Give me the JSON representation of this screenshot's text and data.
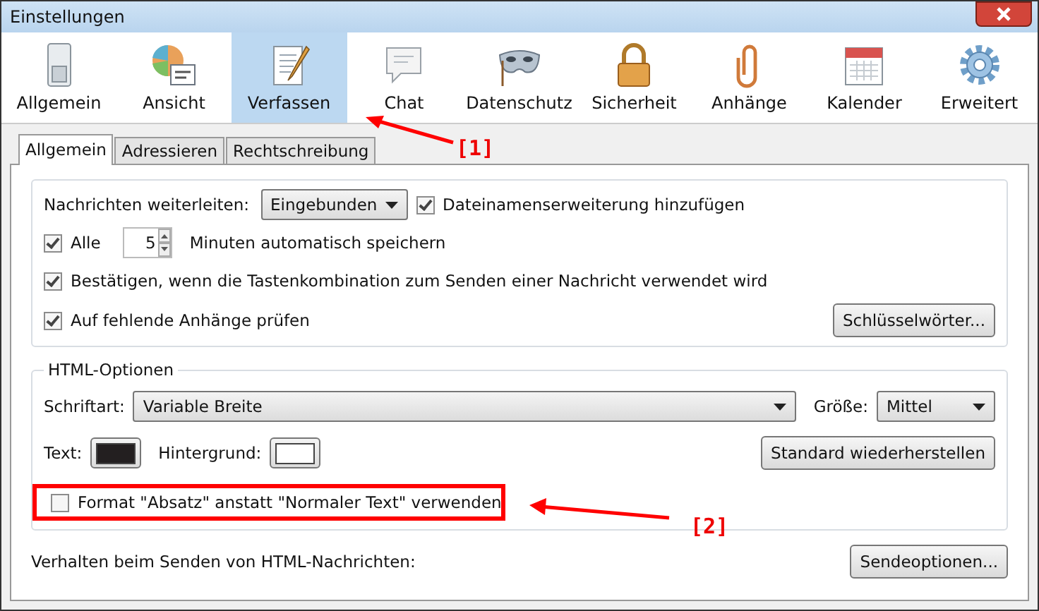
{
  "window": {
    "title": "Einstellungen"
  },
  "toolbar": [
    {
      "label": "Allgemein",
      "selected": false
    },
    {
      "label": "Ansicht",
      "selected": false
    },
    {
      "label": "Verfassen",
      "selected": true
    },
    {
      "label": "Chat",
      "selected": false
    },
    {
      "label": "Datenschutz",
      "selected": false
    },
    {
      "label": "Sicherheit",
      "selected": false
    },
    {
      "label": "Anhänge",
      "selected": false
    },
    {
      "label": "Kalender",
      "selected": false
    },
    {
      "label": "Erweitert",
      "selected": false
    }
  ],
  "tabs": [
    {
      "label": "Allgemein",
      "selected": true
    },
    {
      "label": "Adressieren",
      "selected": false
    },
    {
      "label": "Rechtschreibung",
      "selected": false
    }
  ],
  "general": {
    "forward_label": "Nachrichten weiterleiten:",
    "forward_value": "Eingebunden",
    "extension": {
      "label": "Dateinamenserweiterung hinzufügen",
      "checked": true
    },
    "autosave": {
      "label": "Alle",
      "checked": true,
      "value": "5",
      "suffix": "Minuten automatisch speichern"
    },
    "confirm": {
      "label": "Bestätigen, wenn die Tastenkombination zum Senden einer Nachricht verwendet wird",
      "checked": true
    },
    "attachments": {
      "label": "Auf fehlende Anhänge prüfen",
      "checked": true
    },
    "keywords_button": "Schlüsselwörter..."
  },
  "html_options": {
    "legend": "HTML-Optionen",
    "font_label": "Schriftart:",
    "font_value": "Variable Breite",
    "size_label": "Größe:",
    "size_value": "Mittel",
    "text_label": "Text:",
    "background_label": "Hintergrund:",
    "restore_button": "Standard wiederherstellen",
    "paragraph": {
      "label": "Format \"Absatz\" anstatt \"Normaler Text\" verwenden",
      "checked": false
    }
  },
  "send": {
    "label": "Verhalten beim Senden von HTML-Nachrichten:",
    "button": "Sendeoptionen..."
  },
  "annotations": [
    {
      "label": "[1]"
    },
    {
      "label": "[2]"
    }
  ]
}
